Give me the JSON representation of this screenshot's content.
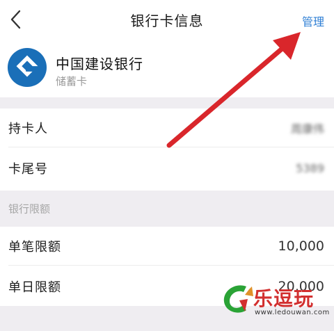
{
  "header": {
    "title": "银行卡信息",
    "manage_label": "管理"
  },
  "bank": {
    "name": "中国建设银行",
    "card_type": "储蓄卡",
    "logo_icon": "ccb-logo-icon",
    "brand_color": "#1a6fb8"
  },
  "details": {
    "holder_label": "持卡人",
    "holder_value": "周康伟",
    "tail_label": "卡尾号",
    "tail_value": "5389"
  },
  "limits": {
    "section_title": "银行限额",
    "single_label": "单笔限额",
    "single_value": "10,000",
    "daily_label": "单日限额",
    "daily_value": "20,000"
  },
  "watermark": {
    "title": "乐逗玩",
    "url": "www.ledouwan.com"
  },
  "colors": {
    "accent": "#2f7fd4",
    "arrow": "#d9262b",
    "section_bg": "#efedf1"
  }
}
